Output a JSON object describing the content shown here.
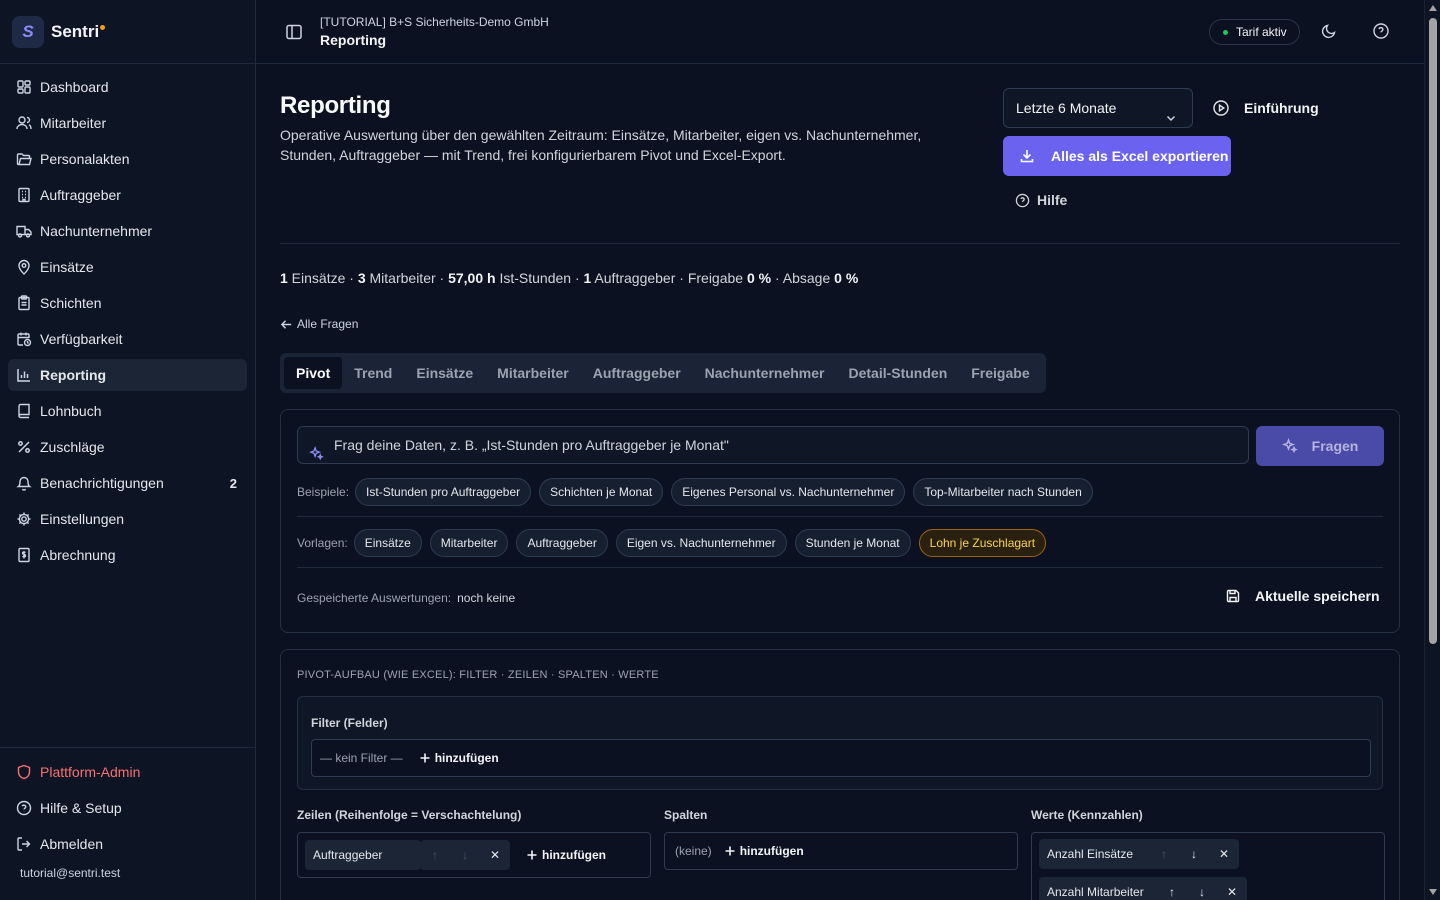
{
  "brand": {
    "logo_letter": "S",
    "name": "Sentri"
  },
  "sidebar": {
    "items": [
      {
        "label": "Dashboard",
        "icon": "dashboard-icon"
      },
      {
        "label": "Mitarbeiter",
        "icon": "users-icon"
      },
      {
        "label": "Personalakten",
        "icon": "folder-icon"
      },
      {
        "label": "Auftraggeber",
        "icon": "building-icon"
      },
      {
        "label": "Nachunternehmer",
        "icon": "truck-icon"
      },
      {
        "label": "Einsätze",
        "icon": "map-pin-icon"
      },
      {
        "label": "Schichten",
        "icon": "clipboard-icon"
      },
      {
        "label": "Verfügbarkeit",
        "icon": "calendar-clock-icon"
      },
      {
        "label": "Reporting",
        "icon": "bar-chart-icon",
        "active": true
      },
      {
        "label": "Lohnbuch",
        "icon": "book-icon"
      },
      {
        "label": "Zuschläge",
        "icon": "percent-icon"
      },
      {
        "label": "Benachrichtigungen",
        "icon": "bell-icon",
        "count": "2"
      },
      {
        "label": "Einstellungen",
        "icon": "gear-icon"
      },
      {
        "label": "Abrechnung",
        "icon": "receipt-icon"
      }
    ],
    "bottom": {
      "admin": "Plattform-Admin",
      "help": "Hilfe & Setup",
      "logout": "Abmelden",
      "email": "tutorial@sentri.test"
    }
  },
  "topbar": {
    "org": "[TUTORIAL] B+S Sicherheits-Demo GmbH",
    "page": "Reporting",
    "tarif": "Tarif aktiv"
  },
  "header": {
    "title": "Reporting",
    "description": "Operative Auswertung über den gewählten Zeitraum: Einsätze, Mitarbeiter, eigen vs. Nachunternehmer, Stunden, Auftraggeber — mit Trend, frei konfigurierbarem Pivot und Excel-Export.",
    "period": "Letzte 6 Monate",
    "intro": "Einführung",
    "export": "Alles als Excel exportieren",
    "help": "Hilfe"
  },
  "summary": {
    "einsaetze_num": "1",
    "einsaetze_label": " Einsätze · ",
    "mitarbeiter_num": "3",
    "mitarbeiter_label": " Mitarbeiter · ",
    "stunden_num": "57,00 h",
    "stunden_label": " Ist-Stunden · ",
    "auftraggeber_num": "1",
    "auftraggeber_label": " Auftraggeber · Freigabe ",
    "freigabe": "0 %",
    "absage_label": " · Absage ",
    "absage": "0 %"
  },
  "back_link": "Alle Fragen",
  "tabs": [
    "Pivot",
    "Trend",
    "Einsätze",
    "Mitarbeiter",
    "Auftraggeber",
    "Nachunternehmer",
    "Detail-Stunden",
    "Freigabe"
  ],
  "ask": {
    "placeholder": "Frag deine Daten, z. B. „Ist-Stunden pro Auftraggeber je Monat\"",
    "button": "Fragen",
    "examples_label": "Beispiele:",
    "examples": [
      "Ist-Stunden pro Auftraggeber",
      "Schichten je Monat",
      "Eigenes Personal vs. Nachunternehmer",
      "Top-Mitarbeiter nach Stunden"
    ],
    "templates_label": "Vorlagen:",
    "templates": [
      "Einsätze",
      "Mitarbeiter",
      "Auftraggeber",
      "Eigen vs. Nachunternehmer",
      "Stunden je Monat",
      "Lohn je Zuschlagart"
    ],
    "saved_label": "Gespeicherte Auswertungen:",
    "saved_value": "noch keine",
    "save_button": "Aktuelle speichern"
  },
  "pivot": {
    "title": "PIVOT-AUFBAU (WIE EXCEL): FILTER · ZEILEN · SPALTEN · WERTE",
    "filter_label": "Filter (Felder)",
    "filter_empty": "— kein Filter —",
    "add": "hinzufügen",
    "rows_label": "Zeilen (Reihenfolge = Verschachtelung)",
    "rows": [
      "Auftraggeber"
    ],
    "columns_label": "Spalten",
    "columns_empty": "(keine)",
    "values_label": "Werte (Kennzahlen)",
    "values": [
      "Anzahl Einsätze",
      "Anzahl Mitarbeiter"
    ]
  }
}
